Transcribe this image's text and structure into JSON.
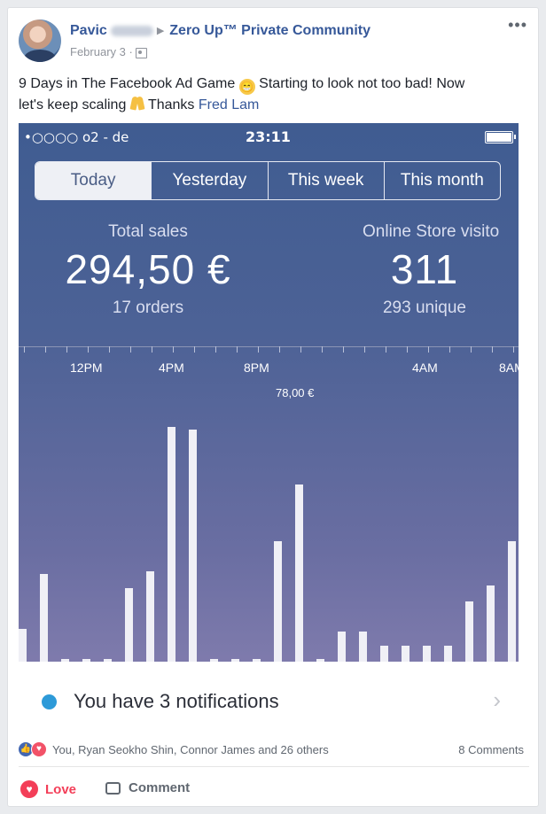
{
  "post": {
    "author": "Pavic",
    "group": "Zero Up™ Private Community",
    "date": "February 3 ·",
    "more": "•••",
    "text_line1": "9 Days in The Facebook Ad Game ",
    "text_line1b": " Starting to look not too bad! Now",
    "text_line2": "let's keep scaling ",
    "text_line2b": " Thanks ",
    "mention": "Fred Lam",
    "emoji_grin": "😁"
  },
  "phone": {
    "carrier": "•○○○○ o2 - de",
    "time": "23:11",
    "tabs": [
      "Today",
      "Yesterday",
      "This week",
      "This month"
    ],
    "active_tab": "Today",
    "total_sales_label": "Total sales",
    "total_sales_value": "294,50 €",
    "orders": "17 orders",
    "visitors_label": "Online Store visito",
    "visitors_value": "311",
    "unique": "293 unique",
    "time_labels": [
      "12PM",
      "4PM",
      "8PM",
      "4AM",
      "8AM"
    ],
    "peak_label": "78,00 €",
    "notification_text": "You have 3 notifications",
    "bar_values": [
      0.12,
      0.32,
      0.01,
      0.01,
      0.01,
      0.27,
      0.33,
      0.86,
      0.85,
      0.01,
      0.01,
      0.01,
      0.44,
      0.65,
      0.01,
      0.11,
      0.11,
      0.06,
      0.06,
      0.06,
      0.06,
      0.22,
      0.28,
      0.44
    ]
  },
  "footer": {
    "reactors": "You, Ryan Seokho Shin, Connor James and 26 others",
    "comments": "8 Comments",
    "love_label": "Love",
    "comment_label": "Comment"
  }
}
